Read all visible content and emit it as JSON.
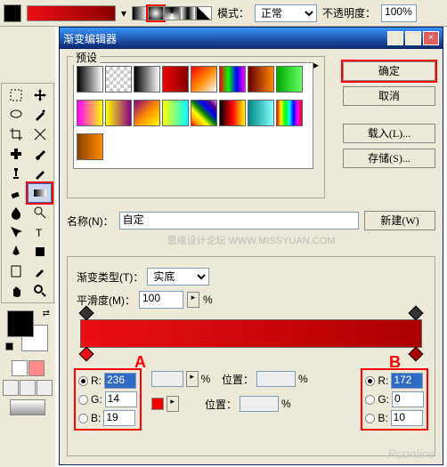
{
  "topbar": {
    "mode_label": "模式：",
    "mode_value": "正常",
    "opacity_label": "不透明度：",
    "opacity_value": "100%"
  },
  "dialog": {
    "title": "渐变编辑器",
    "presets_label": "预设",
    "buttons": {
      "ok": "确定",
      "cancel": "取消",
      "load": "载入(L)...",
      "save": "存储(S)..."
    },
    "name_label": "名称(N)：",
    "name_value": "自定",
    "new_btn": "新建(W)",
    "watermark": "思缘设计论坛   WWW.MISSYUAN.COM",
    "type_label": "渐变类型(T)：",
    "type_value": "实底",
    "smooth_label": "平滑度(M)：",
    "smooth_value": "100",
    "smooth_unit": "%",
    "stop_opacity_unit": "%",
    "pos_label": "位置：",
    "pos_unit": "%",
    "markA": "A",
    "markB": "B",
    "colorA": {
      "R_label": "R:",
      "R": "236",
      "G_label": "G:",
      "G": "14",
      "B_label": "B:",
      "B": "19"
    },
    "colorB": {
      "R_label": "R:",
      "R": "172",
      "G_label": "G:",
      "G": "0",
      "B_label": "B:",
      "B": "10"
    }
  },
  "icons": {
    "win_min": "_",
    "win_max": "□",
    "win_close": "×",
    "dropdown": "▾",
    "play": "▸",
    "swap": "⇄"
  },
  "footer_wm": "Pconline"
}
